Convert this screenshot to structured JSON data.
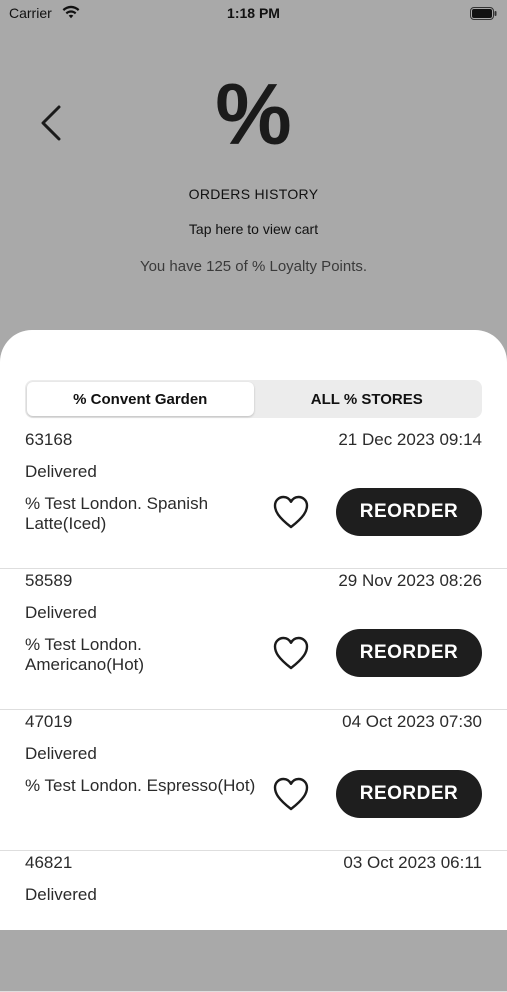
{
  "status_bar": {
    "carrier": "Carrier",
    "time": "1:18 PM"
  },
  "header": {
    "logo": "%",
    "title": "ORDERS HISTORY",
    "view_cart": "Tap here to view cart",
    "loyalty": "You have 125 of % Loyalty Points."
  },
  "tabs": [
    {
      "label": "% Convent Garden",
      "active": true
    },
    {
      "label": "ALL % STORES",
      "active": false
    }
  ],
  "orders": [
    {
      "number": "63168",
      "date": "21 Dec 2023 09:14",
      "status": "Delivered",
      "description": "% Test London. Spanish Latte(Iced)",
      "action": "REORDER"
    },
    {
      "number": "58589",
      "date": "29 Nov 2023 08:26",
      "status": "Delivered",
      "description": "% Test London. Americano(Hot)",
      "action": "REORDER"
    },
    {
      "number": "47019",
      "date": "04 Oct 2023 07:30",
      "status": "Delivered",
      "description": "% Test London. Espresso(Hot)",
      "action": "REORDER"
    },
    {
      "number": "46821",
      "date": "03 Oct 2023 06:11",
      "status": "Delivered"
    }
  ],
  "colors": {
    "header_bg": "#a9a9a9",
    "button_bg": "#1e1e1e",
    "button_text": "#ffffff"
  },
  "icons": [
    "wifi-icon",
    "battery-icon",
    "back-chevron-icon",
    "heart-outline-icon"
  ]
}
